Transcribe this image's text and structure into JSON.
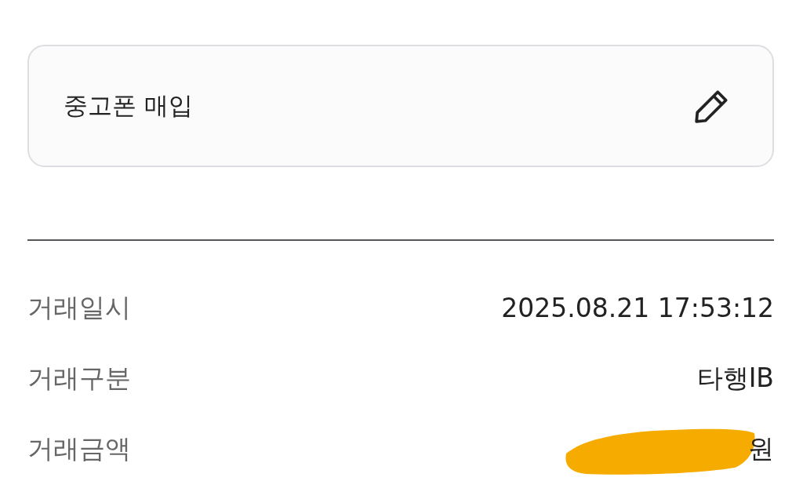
{
  "memo_card": {
    "text": "중고폰 매입"
  },
  "details": [
    {
      "label": "거래일시",
      "value": "2025.08.21 17:53:12",
      "redacted": false
    },
    {
      "label": "거래구분",
      "value": "타행IB",
      "redacted": false
    },
    {
      "label": "거래금액",
      "value": "원",
      "redacted": true
    }
  ]
}
